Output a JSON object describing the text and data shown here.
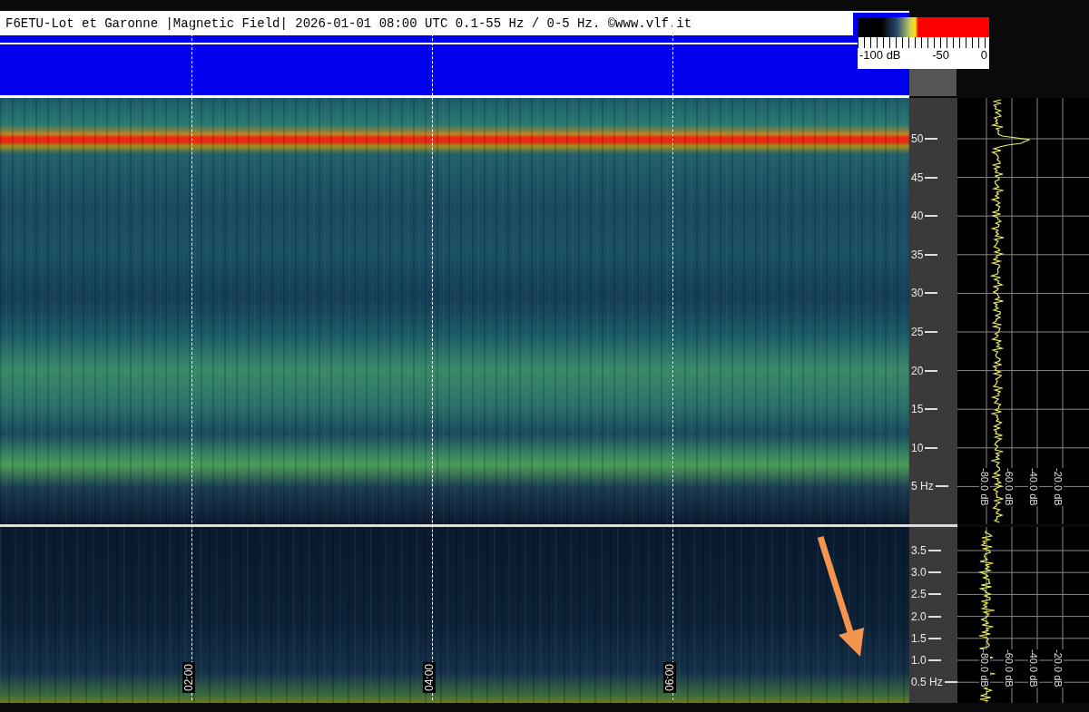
{
  "header": {
    "title": "F6ETU-Lot et Garonne |Magnetic Field| 2026-01-01 08:00 UTC 0.1-55 Hz / 0-5 Hz. ©www.vlf.it"
  },
  "color_scale": {
    "labels": [
      "-100 dB",
      "-50",
      "0"
    ]
  },
  "time_markers": [
    "02:00",
    "04:00",
    "06:00"
  ],
  "upper_panel": {
    "freq_labels": [
      "50",
      "45",
      "40",
      "35",
      "30",
      "25",
      "20",
      "15",
      "10",
      "5 Hz"
    ],
    "db_labels": [
      "-80.0 dB",
      "-60.0 dB",
      "-40.0 dB",
      "-20.0 dB"
    ]
  },
  "lower_panel": {
    "freq_labels": [
      "3.5",
      "3.0",
      "2.5",
      "2.0",
      "1.5",
      "1.0",
      "0.5 Hz"
    ],
    "db_labels": [
      "-80.0 dB",
      "-60.0 dB",
      "-40.0 dB",
      "-20.0 dB"
    ]
  }
}
